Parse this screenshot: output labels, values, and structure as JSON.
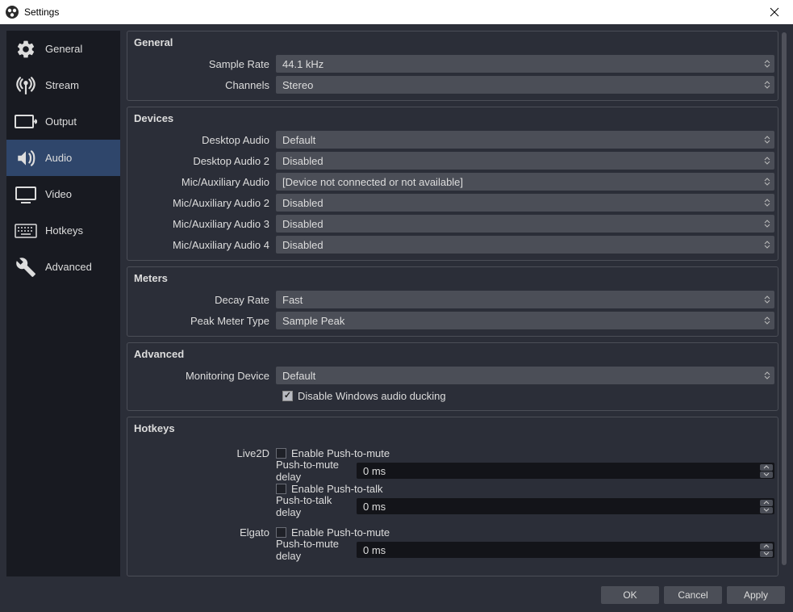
{
  "window": {
    "title": "Settings"
  },
  "sidebar": {
    "items": [
      {
        "label": "General"
      },
      {
        "label": "Stream"
      },
      {
        "label": "Output"
      },
      {
        "label": "Audio"
      },
      {
        "label": "Video"
      },
      {
        "label": "Hotkeys"
      },
      {
        "label": "Advanced"
      }
    ]
  },
  "groups": {
    "general": {
      "title": "General",
      "sample_rate_label": "Sample Rate",
      "sample_rate_value": "44.1 kHz",
      "channels_label": "Channels",
      "channels_value": "Stereo"
    },
    "devices": {
      "title": "Devices",
      "rows": [
        {
          "label": "Desktop Audio",
          "value": "Default"
        },
        {
          "label": "Desktop Audio 2",
          "value": "Disabled"
        },
        {
          "label": "Mic/Auxiliary Audio",
          "value": "[Device not connected or not available]"
        },
        {
          "label": "Mic/Auxiliary Audio 2",
          "value": "Disabled"
        },
        {
          "label": "Mic/Auxiliary Audio 3",
          "value": "Disabled"
        },
        {
          "label": "Mic/Auxiliary Audio 4",
          "value": "Disabled"
        }
      ]
    },
    "meters": {
      "title": "Meters",
      "decay_label": "Decay Rate",
      "decay_value": "Fast",
      "peak_label": "Peak Meter Type",
      "peak_value": "Sample Peak"
    },
    "advanced": {
      "title": "Advanced",
      "monitoring_label": "Monitoring Device",
      "monitoring_value": "Default",
      "ducking_label": "Disable Windows audio ducking"
    },
    "hotkeys": {
      "title": "Hotkeys",
      "ptm_label": "Enable Push-to-mute",
      "ptm_delay_label": "Push-to-mute delay",
      "ptt_label": "Enable Push-to-talk",
      "ptt_delay_label": "Push-to-talk delay",
      "delay_value": "0 ms",
      "devices": [
        {
          "name": "Live2D"
        },
        {
          "name": "Elgato"
        }
      ]
    }
  },
  "footer": {
    "ok": "OK",
    "cancel": "Cancel",
    "apply": "Apply"
  }
}
